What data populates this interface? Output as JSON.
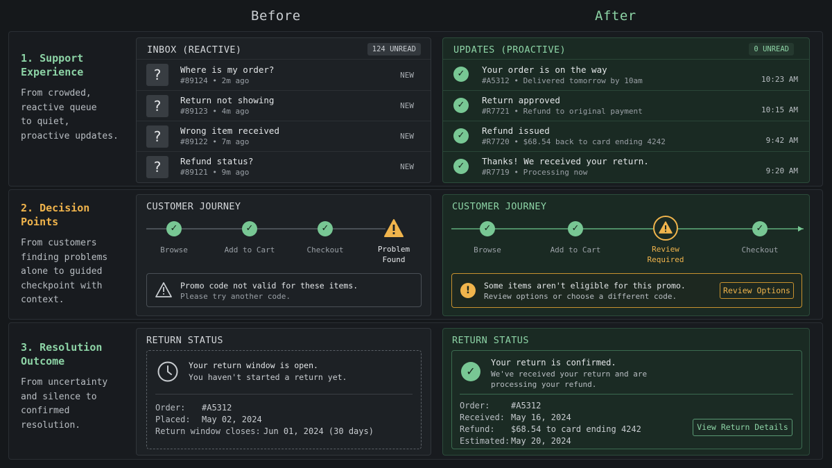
{
  "columns": {
    "before": "Before",
    "after": "After"
  },
  "rows": [
    {
      "title": "1. Support Experience",
      "title_lines": [
        "1. Support",
        "Experience"
      ],
      "desc_lines": [
        "From crowded,",
        "reactive queue",
        "to quiet,",
        "proactive updates."
      ]
    },
    {
      "title_lines": [
        "2. Decision",
        "Points"
      ],
      "desc_lines": [
        "From customers",
        "finding problems",
        "alone to guided",
        "checkpoint with",
        "context."
      ]
    },
    {
      "title_lines": [
        "3. Resolution",
        "Outcome"
      ],
      "desc_lines": [
        "From uncertainty",
        "and silence to",
        "confirmed",
        "resolution."
      ]
    }
  ],
  "inbox": {
    "title": "INBOX (REACTIVE)",
    "badge": "124 UNREAD",
    "items": [
      {
        "subject": "Where is my order?",
        "meta": "#89124  •  2m ago",
        "tag": "NEW"
      },
      {
        "subject": "Return not showing",
        "meta": "#89123  •  4m ago",
        "tag": "NEW"
      },
      {
        "subject": "Wrong item received",
        "meta": "#89122  •  7m ago",
        "tag": "NEW"
      },
      {
        "subject": "Refund status?",
        "meta": "#89121  •  9m ago",
        "tag": "NEW"
      }
    ]
  },
  "updates": {
    "title": "UPDATES (PROACTIVE)",
    "badge": "0 UNREAD",
    "items": [
      {
        "subject": "Your order is on the way",
        "meta": "#A5312  •  Delivered tomorrow by 10am",
        "time": "10:23 AM"
      },
      {
        "subject": "Return approved",
        "meta": "#R7721  •  Refund to original payment",
        "time": "10:15 AM"
      },
      {
        "subject": "Refund issued",
        "meta": "#R7720  •  $68.54 back to card ending 4242",
        "time": "9:42 AM"
      },
      {
        "subject": "Thanks! We received your return.",
        "meta": "#R7719  •  Processing now",
        "time": "9:20 AM"
      }
    ]
  },
  "journey_before": {
    "title": "CUSTOMER JOURNEY",
    "steps": [
      "Browse",
      "Add to Cart",
      "Checkout"
    ],
    "problem_lines": [
      "Problem",
      "Found"
    ],
    "alert_line1": "Promo code not valid for these items.",
    "alert_line2": "Please try another code."
  },
  "journey_after": {
    "title": "CUSTOMER JOURNEY",
    "steps": [
      "Browse",
      "Add to Cart",
      "Checkout"
    ],
    "review_lines": [
      "Review",
      "Required"
    ],
    "alert_line1": "Some items aren't eligible for this promo.",
    "alert_line2": "Review options or choose a different code.",
    "button": "Review Options"
  },
  "return_before": {
    "title": "RETURN STATUS",
    "line1": "Your return window is open.",
    "line2": "You haven't started a return yet.",
    "details": [
      {
        "k": "Order:",
        "v": "#A5312"
      },
      {
        "k": "Placed:",
        "v": "May 02, 2024"
      },
      {
        "k": "Return window closes:",
        "v": "Jun 01, 2024 (30 days)"
      }
    ]
  },
  "return_after": {
    "title": "RETURN STATUS",
    "line1": "Your return is confirmed.",
    "line2": "We've received your return and are",
    "line3": "processing your refund.",
    "details": [
      {
        "k": "Order:",
        "v": "#A5312"
      },
      {
        "k": "Received:",
        "v": "May 16, 2024"
      },
      {
        "k": "Refund:",
        "v": "$68.54 to card ending 4242"
      },
      {
        "k": "Estimated:",
        "v": "May 20, 2024"
      }
    ],
    "button": "View Return Details"
  },
  "colors": {
    "bg": "#15181b",
    "green": "#78c794",
    "orange": "#f0b44c"
  },
  "icons": {
    "question": "question-icon",
    "check": "check-circle-icon",
    "warning": "warning-icon",
    "clock": "clock-icon"
  }
}
